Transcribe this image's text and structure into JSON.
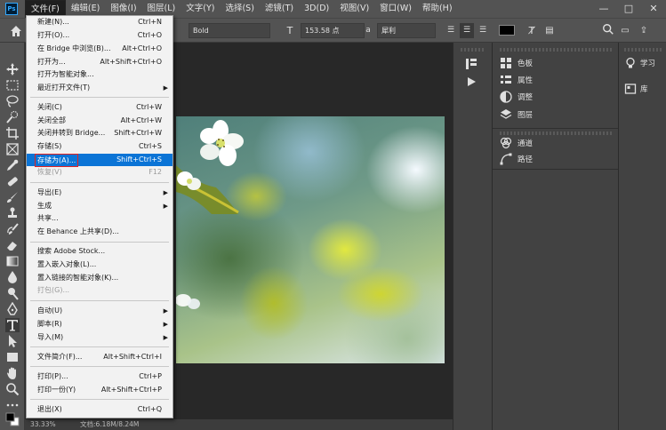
{
  "menubar": {
    "items": [
      "文件(F)",
      "编辑(E)",
      "图像(I)",
      "图层(L)",
      "文字(Y)",
      "选择(S)",
      "滤镜(T)",
      "3D(D)",
      "视图(V)",
      "窗口(W)",
      "帮助(H)"
    ],
    "logo": "Ps",
    "window_controls": [
      "—",
      "□",
      "✕"
    ]
  },
  "options_bar": {
    "font_style": "Bold",
    "font_size": "153.58 点",
    "antialias": "犀利",
    "text_color": "#000000"
  },
  "file_menu": {
    "items": [
      {
        "label": "新建(N)...",
        "shortcut": "Ctrl+N"
      },
      {
        "label": "打开(O)...",
        "shortcut": "Ctrl+O"
      },
      {
        "label": "在 Bridge 中浏览(B)...",
        "shortcut": "Alt+Ctrl+O"
      },
      {
        "label": "打开为...",
        "shortcut": "Alt+Shift+Ctrl+O"
      },
      {
        "label": "打开为智能对象...",
        "shortcut": ""
      },
      {
        "label": "最近打开文件(T)",
        "shortcut": "",
        "submenu": true
      },
      {
        "label": "关闭(C)",
        "shortcut": "Ctrl+W"
      },
      {
        "label": "关闭全部",
        "shortcut": "Alt+Ctrl+W"
      },
      {
        "label": "关闭并转到 Bridge...",
        "shortcut": "Shift+Ctrl+W"
      },
      {
        "label": "存储(S)",
        "shortcut": "Ctrl+S"
      },
      {
        "label": "存储为(A)...",
        "shortcut": "Shift+Ctrl+S",
        "highlighted": true
      },
      {
        "label": "恢复(V)",
        "shortcut": "F12",
        "disabled": true
      },
      {
        "label": "导出(E)",
        "shortcut": "",
        "submenu": true
      },
      {
        "label": "生成",
        "shortcut": "",
        "submenu": true
      },
      {
        "label": "共享...",
        "shortcut": ""
      },
      {
        "label": "在 Behance 上共享(D)...",
        "shortcut": ""
      },
      {
        "label": "搜索 Adobe Stock...",
        "shortcut": ""
      },
      {
        "label": "置入嵌入对象(L)...",
        "shortcut": ""
      },
      {
        "label": "置入链接的智能对象(K)...",
        "shortcut": ""
      },
      {
        "label": "打包(G)...",
        "shortcut": "",
        "disabled": true
      },
      {
        "label": "自动(U)",
        "shortcut": "",
        "submenu": true
      },
      {
        "label": "脚本(R)",
        "shortcut": "",
        "submenu": true
      },
      {
        "label": "导入(M)",
        "shortcut": "",
        "submenu": true
      },
      {
        "label": "文件简介(F)...",
        "shortcut": "Alt+Shift+Ctrl+I"
      },
      {
        "label": "打印(P)...",
        "shortcut": "Ctrl+P"
      },
      {
        "label": "打印一份(Y)",
        "shortcut": "Alt+Shift+Ctrl+P"
      },
      {
        "label": "退出(X)",
        "shortcut": "Ctrl+Q"
      }
    ]
  },
  "panels": {
    "group1": [
      "色板",
      "属性",
      "调整",
      "图层"
    ],
    "group2": [
      "通道",
      "路径"
    ],
    "right": [
      "学习",
      "库"
    ]
  },
  "status": {
    "zoom": "33.33%",
    "doc_info": "文档:6.18M/8.24M"
  }
}
